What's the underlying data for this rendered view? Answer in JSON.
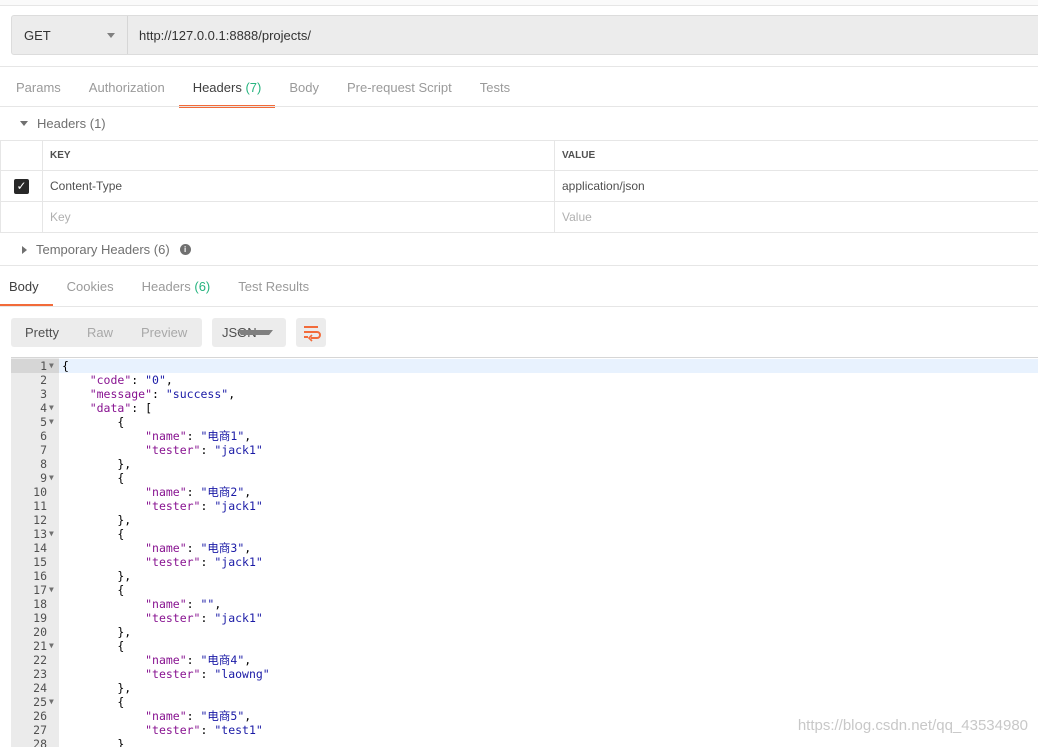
{
  "request": {
    "method": "GET",
    "url": "http://127.0.0.1:8888/projects/"
  },
  "request_tabs": [
    {
      "label": "Params"
    },
    {
      "label": "Authorization"
    },
    {
      "label": "Headers",
      "count": "(7)",
      "active": true
    },
    {
      "label": "Body"
    },
    {
      "label": "Pre-request Script"
    },
    {
      "label": "Tests"
    }
  ],
  "headers_section": {
    "title": "Headers (1)",
    "key_col": "KEY",
    "value_col": "VALUE",
    "rows": [
      {
        "checked": true,
        "key": "Content-Type",
        "value": "application/json"
      }
    ],
    "key_placeholder": "Key",
    "value_placeholder": "Value"
  },
  "temp_headers": {
    "title": "Temporary Headers (6)",
    "info_icon": "i"
  },
  "response_tabs": [
    {
      "label": "Body",
      "active": true
    },
    {
      "label": "Cookies"
    },
    {
      "label": "Headers",
      "count": "(6)"
    },
    {
      "label": "Test Results"
    }
  ],
  "view_modes": [
    "Pretty",
    "Raw",
    "Preview"
  ],
  "format": "JSON",
  "accent": "#f26b3a",
  "code_lines": [
    {
      "n": "1",
      "fold": true,
      "t": [
        [
          "p",
          "{"
        ]
      ]
    },
    {
      "n": "2",
      "t": [
        [
          "p",
          "    "
        ],
        [
          "k",
          "\"code\""
        ],
        [
          "p",
          ": "
        ],
        [
          "s",
          "\"0\""
        ],
        [
          "p",
          ","
        ]
      ]
    },
    {
      "n": "3",
      "t": [
        [
          "p",
          "    "
        ],
        [
          "k",
          "\"message\""
        ],
        [
          "p",
          ": "
        ],
        [
          "s",
          "\"success\""
        ],
        [
          "p",
          ","
        ]
      ]
    },
    {
      "n": "4",
      "fold": true,
      "t": [
        [
          "p",
          "    "
        ],
        [
          "k",
          "\"data\""
        ],
        [
          "p",
          ": ["
        ]
      ]
    },
    {
      "n": "5",
      "fold": true,
      "t": [
        [
          "p",
          "        {"
        ]
      ]
    },
    {
      "n": "6",
      "t": [
        [
          "p",
          "            "
        ],
        [
          "k",
          "\"name\""
        ],
        [
          "p",
          ": "
        ],
        [
          "s",
          "\"电商1\""
        ],
        [
          "p",
          ","
        ]
      ]
    },
    {
      "n": "7",
      "t": [
        [
          "p",
          "            "
        ],
        [
          "k",
          "\"tester\""
        ],
        [
          "p",
          ": "
        ],
        [
          "s",
          "\"jack1\""
        ]
      ]
    },
    {
      "n": "8",
      "t": [
        [
          "p",
          "        },"
        ]
      ]
    },
    {
      "n": "9",
      "fold": true,
      "t": [
        [
          "p",
          "        {"
        ]
      ]
    },
    {
      "n": "10",
      "t": [
        [
          "p",
          "            "
        ],
        [
          "k",
          "\"name\""
        ],
        [
          "p",
          ": "
        ],
        [
          "s",
          "\"电商2\""
        ],
        [
          "p",
          ","
        ]
      ]
    },
    {
      "n": "11",
      "t": [
        [
          "p",
          "            "
        ],
        [
          "k",
          "\"tester\""
        ],
        [
          "p",
          ": "
        ],
        [
          "s",
          "\"jack1\""
        ]
      ]
    },
    {
      "n": "12",
      "t": [
        [
          "p",
          "        },"
        ]
      ]
    },
    {
      "n": "13",
      "fold": true,
      "t": [
        [
          "p",
          "        {"
        ]
      ]
    },
    {
      "n": "14",
      "t": [
        [
          "p",
          "            "
        ],
        [
          "k",
          "\"name\""
        ],
        [
          "p",
          ": "
        ],
        [
          "s",
          "\"电商3\""
        ],
        [
          "p",
          ","
        ]
      ]
    },
    {
      "n": "15",
      "t": [
        [
          "p",
          "            "
        ],
        [
          "k",
          "\"tester\""
        ],
        [
          "p",
          ": "
        ],
        [
          "s",
          "\"jack1\""
        ]
      ]
    },
    {
      "n": "16",
      "t": [
        [
          "p",
          "        },"
        ]
      ]
    },
    {
      "n": "17",
      "fold": true,
      "t": [
        [
          "p",
          "        {"
        ]
      ]
    },
    {
      "n": "18",
      "t": [
        [
          "p",
          "            "
        ],
        [
          "k",
          "\"name\""
        ],
        [
          "p",
          ": "
        ],
        [
          "s",
          "\"\""
        ],
        [
          "p",
          ","
        ]
      ]
    },
    {
      "n": "19",
      "t": [
        [
          "p",
          "            "
        ],
        [
          "k",
          "\"tester\""
        ],
        [
          "p",
          ": "
        ],
        [
          "s",
          "\"jack1\""
        ]
      ]
    },
    {
      "n": "20",
      "t": [
        [
          "p",
          "        },"
        ]
      ]
    },
    {
      "n": "21",
      "fold": true,
      "t": [
        [
          "p",
          "        {"
        ]
      ]
    },
    {
      "n": "22",
      "t": [
        [
          "p",
          "            "
        ],
        [
          "k",
          "\"name\""
        ],
        [
          "p",
          ": "
        ],
        [
          "s",
          "\"电商4\""
        ],
        [
          "p",
          ","
        ]
      ]
    },
    {
      "n": "23",
      "t": [
        [
          "p",
          "            "
        ],
        [
          "k",
          "\"tester\""
        ],
        [
          "p",
          ": "
        ],
        [
          "s",
          "\"laowng\""
        ]
      ]
    },
    {
      "n": "24",
      "t": [
        [
          "p",
          "        },"
        ]
      ]
    },
    {
      "n": "25",
      "fold": true,
      "t": [
        [
          "p",
          "        {"
        ]
      ]
    },
    {
      "n": "26",
      "t": [
        [
          "p",
          "            "
        ],
        [
          "k",
          "\"name\""
        ],
        [
          "p",
          ": "
        ],
        [
          "s",
          "\"电商5\""
        ],
        [
          "p",
          ","
        ]
      ]
    },
    {
      "n": "27",
      "t": [
        [
          "p",
          "            "
        ],
        [
          "k",
          "\"tester\""
        ],
        [
          "p",
          ": "
        ],
        [
          "s",
          "\"test1\""
        ]
      ]
    },
    {
      "n": "28",
      "t": [
        [
          "p",
          "        }"
        ]
      ]
    }
  ],
  "watermark": "https://blog.csdn.net/qq_43534980"
}
